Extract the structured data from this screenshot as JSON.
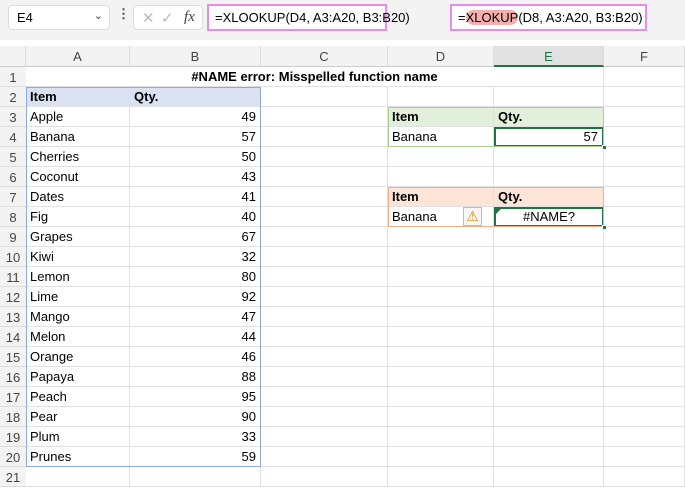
{
  "name_box": "E4",
  "fx_label": "fx",
  "formula_1": "=XLOOKUP(D4, A3:A20, B3:B20)",
  "formula_2": {
    "prefix": "=",
    "highlight": "XLOKUP",
    "rest": "(D8, A3:A20, B3:B20)"
  },
  "columns": [
    "A",
    "B",
    "C",
    "D",
    "E",
    "F"
  ],
  "title": "#NAME error: Misspelled function name",
  "headers": {
    "item": "Item",
    "qty": "Qty."
  },
  "rows": [
    [
      "Apple",
      49
    ],
    [
      "Banana",
      57
    ],
    [
      "Cherries",
      50
    ],
    [
      "Coconut",
      43
    ],
    [
      "Dates",
      41
    ],
    [
      "Fig",
      40
    ],
    [
      "Grapes",
      67
    ],
    [
      "Kiwi",
      32
    ],
    [
      "Lemon",
      80
    ],
    [
      "Lime",
      92
    ],
    [
      "Mango",
      47
    ],
    [
      "Melon",
      44
    ],
    [
      "Orange",
      46
    ],
    [
      "Papaya",
      88
    ],
    [
      "Peach",
      95
    ],
    [
      "Pear",
      90
    ],
    [
      "Plum",
      33
    ],
    [
      "Prunes",
      59
    ]
  ],
  "lookup_ok": {
    "item": "Banana",
    "qty": "57"
  },
  "lookup_err": {
    "item": "Banana",
    "qty": "#NAME?"
  },
  "colors": {
    "table_header": "#d9e1f2",
    "ok_header": "#e2efda",
    "err_header": "#fce4d6",
    "selection": "#217346",
    "formula_outline": "#e98ce9"
  }
}
